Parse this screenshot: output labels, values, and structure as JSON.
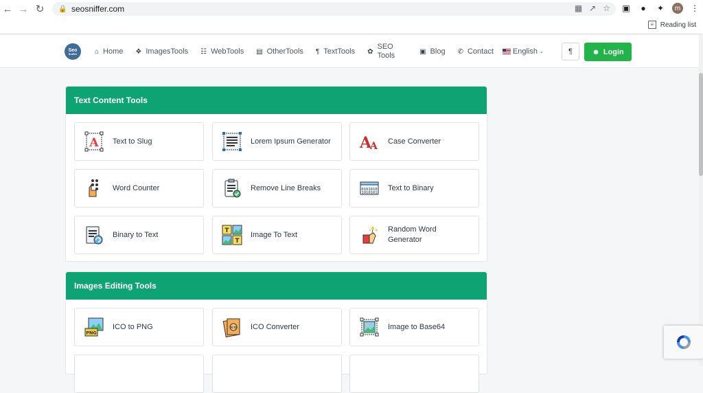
{
  "browser": {
    "url": "seosniffer.com",
    "reading_list_label": "Reading list",
    "profile_initial": "m"
  },
  "site": {
    "logo_top": "Seo",
    "logo_bottom": "Sniffer",
    "nav": [
      {
        "label": "Home",
        "icon": "home-icon"
      },
      {
        "label": "ImagesTools",
        "icon": "grid-icon"
      },
      {
        "label": "WebTools",
        "icon": "sitemap-icon"
      },
      {
        "label": "OtherTools",
        "icon": "toolbox-icon"
      },
      {
        "label": "TextTools",
        "icon": "paragraph-icon"
      },
      {
        "label": "SEO Tools",
        "icon": "rocket-icon"
      },
      {
        "label": "Blog",
        "icon": "blog-icon"
      },
      {
        "label": "Contact",
        "icon": "phone-icon"
      },
      {
        "label": "English",
        "icon": "us-flag-icon"
      }
    ],
    "rtl_label": "¶",
    "login_label": "Login"
  },
  "sections": [
    {
      "title": "Text Content Tools",
      "tools": [
        {
          "label": "Text to Slug",
          "icon": "text-slug-icon"
        },
        {
          "label": "Lorem Ipsum Generator",
          "icon": "lorem-ipsum-icon"
        },
        {
          "label": "Case Converter",
          "icon": "case-converter-icon"
        },
        {
          "label": "Word Counter",
          "icon": "word-counter-icon"
        },
        {
          "label": "Remove Line Breaks",
          "icon": "remove-line-breaks-icon"
        },
        {
          "label": "Text to Binary",
          "icon": "text-binary-icon"
        },
        {
          "label": "Binary to Text",
          "icon": "binary-text-icon"
        },
        {
          "label": "Image To Text",
          "icon": "image-text-icon"
        },
        {
          "label": "Random Word Generator",
          "icon": "random-word-icon"
        }
      ]
    },
    {
      "title": "Images Editing Tools",
      "tools": [
        {
          "label": "ICO to PNG",
          "icon": "ico-png-icon"
        },
        {
          "label": "ICO Converter",
          "icon": "ico-converter-icon"
        },
        {
          "label": "Image to Base64",
          "icon": "image-base64-icon"
        }
      ]
    }
  ],
  "colors": {
    "section_header": "#0fa374",
    "login_button": "#22b34b",
    "logo": "#3f6c96"
  }
}
